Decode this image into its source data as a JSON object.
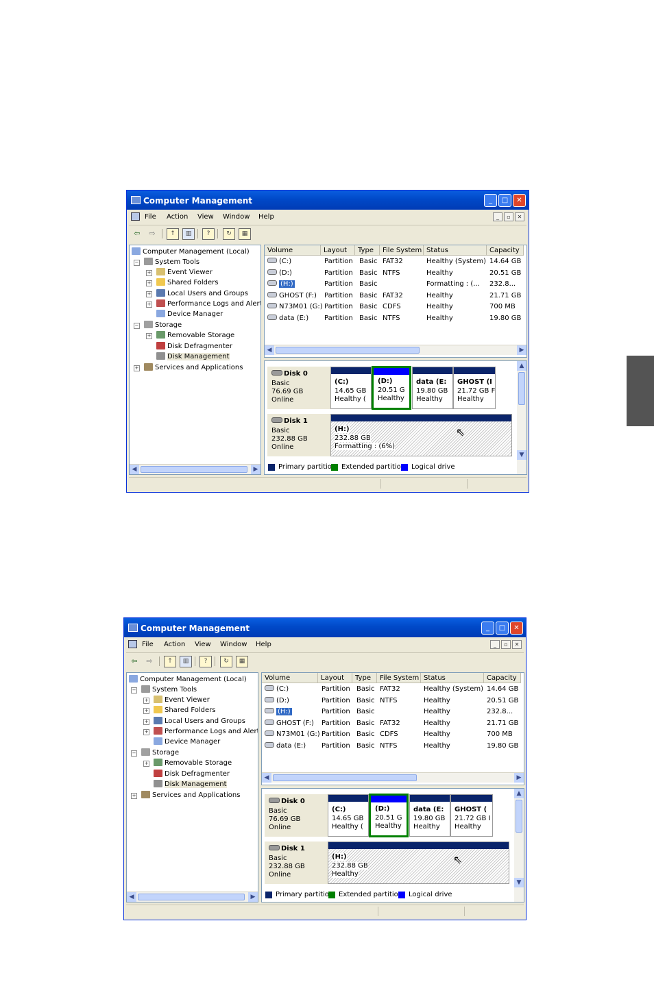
{
  "screens": [
    {
      "window": {
        "title": "Computer Management",
        "menu": [
          "File",
          "Action",
          "View",
          "Window",
          "Help"
        ]
      },
      "tree": [
        {
          "label": "Computer Management (Local)",
          "icon": "computer-icon"
        },
        {
          "label": "System Tools",
          "icon": "tools-icon"
        },
        {
          "label": "Event Viewer",
          "icon": "event-viewer-icon"
        },
        {
          "label": "Shared Folders",
          "icon": "folder-icon"
        },
        {
          "label": "Local Users and Groups",
          "icon": "users-icon"
        },
        {
          "label": "Performance Logs and Alerts",
          "icon": "performance-icon"
        },
        {
          "label": "Device Manager",
          "icon": "device-manager-icon"
        },
        {
          "label": "Storage",
          "icon": "storage-icon"
        },
        {
          "label": "Removable Storage",
          "icon": "removable-storage-icon"
        },
        {
          "label": "Disk Defragmenter",
          "icon": "defrag-icon"
        },
        {
          "label": "Disk Management",
          "icon": "disk-management-icon"
        },
        {
          "label": "Services and Applications",
          "icon": "services-icon"
        }
      ],
      "columns": [
        "Volume",
        "Layout",
        "Type",
        "File System",
        "Status",
        "Capacity"
      ],
      "volumes": [
        {
          "volume": "(C:)",
          "layout": "Partition",
          "type": "Basic",
          "fs": "FAT32",
          "status": "Healthy (System)",
          "capacity": "14.64 GB"
        },
        {
          "volume": "(D:)",
          "layout": "Partition",
          "type": "Basic",
          "fs": "NTFS",
          "status": "Healthy",
          "capacity": "20.51 GB"
        },
        {
          "volume": "(H:)",
          "layout": "Partition",
          "type": "Basic",
          "fs": "",
          "status": "Formatting : (...",
          "capacity": "232.8..."
        },
        {
          "volume": "GHOST (F:)",
          "layout": "Partition",
          "type": "Basic",
          "fs": "FAT32",
          "status": "Healthy",
          "capacity": "21.71 GB"
        },
        {
          "volume": "N73M01 (G:)",
          "layout": "Partition",
          "type": "Basic",
          "fs": "CDFS",
          "status": "Healthy",
          "capacity": "700 MB"
        },
        {
          "volume": "data (E:)",
          "layout": "Partition",
          "type": "Basic",
          "fs": "NTFS",
          "status": "Healthy",
          "capacity": "19.80 GB"
        }
      ],
      "disk0": {
        "name": "Disk 0",
        "kind": "Basic",
        "size": "76.69 GB",
        "state": "Online",
        "partitions": [
          {
            "name": "(C:)",
            "size": "14.65 GB",
            "status": "Healthy ("
          },
          {
            "name": "(D:)",
            "size": "20.51 G",
            "status": "Healthy"
          },
          {
            "name": "data  (E:",
            "size": "19.80 GB",
            "status": "Healthy"
          },
          {
            "name": "GHOST  (I",
            "size": "21.72 GB F",
            "status": "Healthy"
          }
        ]
      },
      "disk1": {
        "name": "Disk 1",
        "kind": "Basic",
        "size": "232.88 GB",
        "state": "Online",
        "partition": {
          "name": "(H:)",
          "size": "232.88 GB",
          "status": "Formatting : (6%)"
        }
      },
      "legend": [
        "Primary partition",
        "Extended partition",
        "Logical drive"
      ]
    },
    {
      "window": {
        "title": "Computer Management",
        "menu": [
          "File",
          "Action",
          "View",
          "Window",
          "Help"
        ]
      },
      "tree": [
        {
          "label": "Computer Management (Local)",
          "icon": "computer-icon"
        },
        {
          "label": "System Tools",
          "icon": "tools-icon"
        },
        {
          "label": "Event Viewer",
          "icon": "event-viewer-icon"
        },
        {
          "label": "Shared Folders",
          "icon": "folder-icon"
        },
        {
          "label": "Local Users and Groups",
          "icon": "users-icon"
        },
        {
          "label": "Performance Logs and Alerts",
          "icon": "performance-icon"
        },
        {
          "label": "Device Manager",
          "icon": "device-manager-icon"
        },
        {
          "label": "Storage",
          "icon": "storage-icon"
        },
        {
          "label": "Removable Storage",
          "icon": "removable-storage-icon"
        },
        {
          "label": "Disk Defragmenter",
          "icon": "defrag-icon"
        },
        {
          "label": "Disk Management",
          "icon": "disk-management-icon"
        },
        {
          "label": "Services and Applications",
          "icon": "services-icon"
        }
      ],
      "columns": [
        "Volume",
        "Layout",
        "Type",
        "File System",
        "Status",
        "Capacity"
      ],
      "volumes": [
        {
          "volume": "(C:)",
          "layout": "Partition",
          "type": "Basic",
          "fs": "FAT32",
          "status": "Healthy (System)",
          "capacity": "14.64 GB"
        },
        {
          "volume": "(D:)",
          "layout": "Partition",
          "type": "Basic",
          "fs": "NTFS",
          "status": "Healthy",
          "capacity": "20.51 GB"
        },
        {
          "volume": "(H:)",
          "layout": "Partition",
          "type": "Basic",
          "fs": "",
          "status": "Healthy",
          "capacity": "232.8..."
        },
        {
          "volume": "GHOST (F:)",
          "layout": "Partition",
          "type": "Basic",
          "fs": "FAT32",
          "status": "Healthy",
          "capacity": "21.71 GB"
        },
        {
          "volume": "N73M01 (G:)",
          "layout": "Partition",
          "type": "Basic",
          "fs": "CDFS",
          "status": "Healthy",
          "capacity": "700 MB"
        },
        {
          "volume": "data (E:)",
          "layout": "Partition",
          "type": "Basic",
          "fs": "NTFS",
          "status": "Healthy",
          "capacity": "19.80 GB"
        }
      ],
      "disk0": {
        "name": "Disk 0",
        "kind": "Basic",
        "size": "76.69 GB",
        "state": "Online",
        "partitions": [
          {
            "name": "(C:)",
            "size": "14.65 GB",
            "status": "Healthy ("
          },
          {
            "name": "(D:)",
            "size": "20.51 G",
            "status": "Healthy"
          },
          {
            "name": "data  (E:",
            "size": "19.80 GB",
            "status": "Healthy"
          },
          {
            "name": "GHOST  (",
            "size": "21.72 GB I",
            "status": "Healthy"
          }
        ]
      },
      "disk1": {
        "name": "Disk 1",
        "kind": "Basic",
        "size": "232.88 GB",
        "state": "Online",
        "partition": {
          "name": "(H:)",
          "size": "232.88 GB",
          "status": "Healthy"
        }
      },
      "legend": [
        "Primary partition",
        "Extended partition",
        "Logical drive"
      ]
    }
  ],
  "colors": {
    "primary": "#0a246a",
    "extended": "#008000",
    "logical": "#0000ff",
    "selected_border": "#008000"
  }
}
